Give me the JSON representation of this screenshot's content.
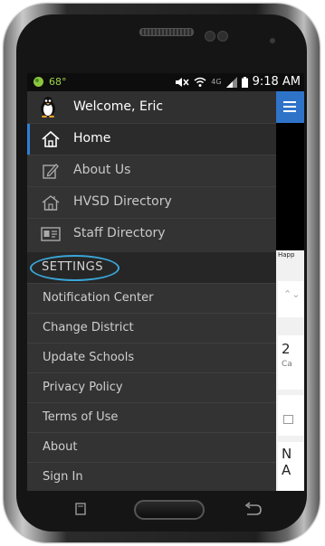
{
  "statusbar": {
    "temp": "68°",
    "network": "4G",
    "time": "9:18 AM"
  },
  "drawer": {
    "welcome": "Welcome, Eric",
    "nav": [
      {
        "label": "Home",
        "icon": "home-icon",
        "active": true
      },
      {
        "label": "About Us",
        "icon": "edit-icon",
        "active": false
      },
      {
        "label": "HVSD Directory",
        "icon": "building-icon",
        "active": false
      },
      {
        "label": "Staff Directory",
        "icon": "id-card-icon",
        "active": false
      }
    ],
    "settings_header": "SETTINGS",
    "settings": [
      {
        "label": "Notification Center"
      },
      {
        "label": "Change District"
      },
      {
        "label": "Update Schools"
      },
      {
        "label": "Privacy Policy"
      },
      {
        "label": "Terms of Use"
      },
      {
        "label": "About"
      },
      {
        "label": "Sign In"
      }
    ]
  },
  "content": {
    "happy_text": "Happ",
    "card_number": "2",
    "card_sub": "Ca",
    "card_heading": "N\nA"
  },
  "colors": {
    "accent": "#2f73c9",
    "highlight_ring": "#3aa6d8",
    "drawer_bg": "#333333"
  }
}
